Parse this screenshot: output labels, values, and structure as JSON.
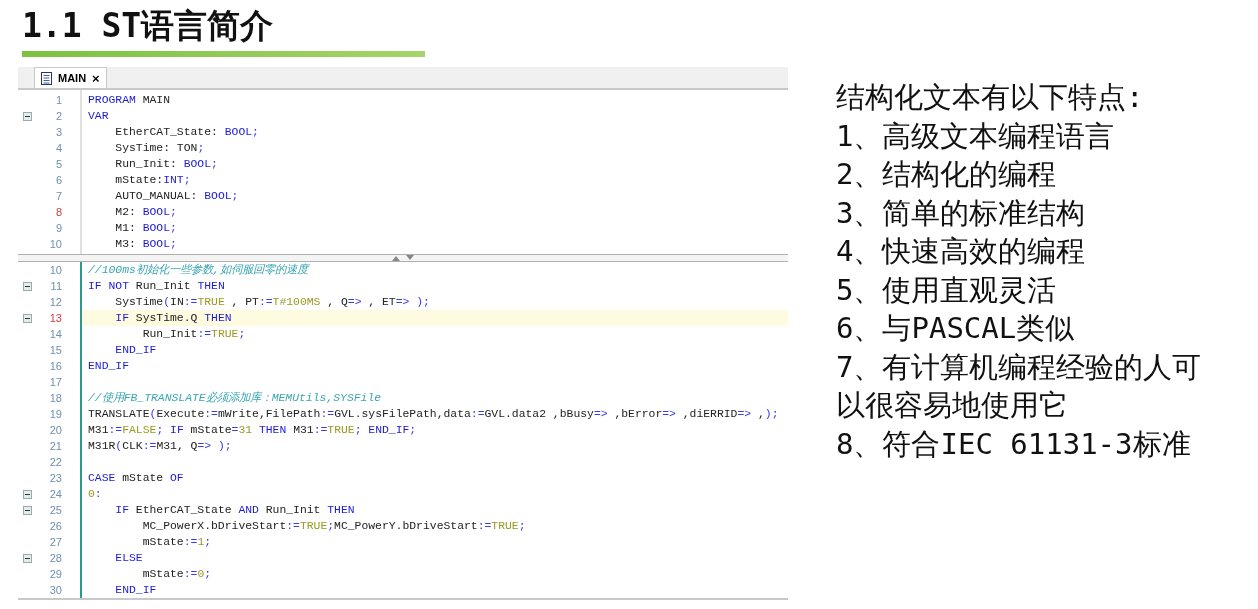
{
  "title": "1.1 ST语言简介",
  "editor": {
    "tab": {
      "label": "MAIN",
      "close": "×"
    },
    "top_pane": [
      {
        "number": "1",
        "folding": false,
        "marked": false,
        "current": false,
        "segments": [
          {
            "kind": "keyword",
            "text": "PROGRAM"
          },
          {
            "kind": "plain",
            "text": " MAIN"
          }
        ]
      },
      {
        "number": "2",
        "folding": true,
        "marked": false,
        "current": false,
        "segments": [
          {
            "kind": "keyword",
            "text": "VAR"
          }
        ]
      },
      {
        "number": "3",
        "folding": false,
        "marked": false,
        "current": false,
        "segments": [
          {
            "kind": "plain",
            "text": "    EtherCAT_State: "
          },
          {
            "kind": "keyword",
            "text": "BOOL"
          },
          {
            "kind": "operator",
            "text": ";"
          }
        ]
      },
      {
        "number": "4",
        "folding": false,
        "marked": false,
        "current": false,
        "segments": [
          {
            "kind": "plain",
            "text": "    SysTime: TON"
          },
          {
            "kind": "operator",
            "text": ";"
          }
        ]
      },
      {
        "number": "5",
        "folding": false,
        "marked": false,
        "current": false,
        "segments": [
          {
            "kind": "plain",
            "text": "    Run_Init: "
          },
          {
            "kind": "keyword",
            "text": "BOOL"
          },
          {
            "kind": "operator",
            "text": ";"
          }
        ]
      },
      {
        "number": "6",
        "folding": false,
        "marked": false,
        "current": false,
        "segments": [
          {
            "kind": "plain",
            "text": "    mState:"
          },
          {
            "kind": "keyword",
            "text": "INT"
          },
          {
            "kind": "operator",
            "text": ";"
          }
        ]
      },
      {
        "number": "7",
        "folding": false,
        "marked": false,
        "current": false,
        "segments": [
          {
            "kind": "plain",
            "text": "    AUTO_MANUAL: "
          },
          {
            "kind": "keyword",
            "text": "BOOL"
          },
          {
            "kind": "operator",
            "text": ";"
          }
        ]
      },
      {
        "number": "8",
        "folding": false,
        "marked": true,
        "current": false,
        "segments": [
          {
            "kind": "plain",
            "text": "    M2: "
          },
          {
            "kind": "keyword",
            "text": "BOOL"
          },
          {
            "kind": "operator",
            "text": ";"
          }
        ]
      },
      {
        "number": "9",
        "folding": false,
        "marked": false,
        "current": false,
        "segments": [
          {
            "kind": "plain",
            "text": "    M1: "
          },
          {
            "kind": "keyword",
            "text": "BOOL"
          },
          {
            "kind": "operator",
            "text": ";"
          }
        ]
      },
      {
        "number": "10",
        "folding": false,
        "marked": false,
        "current": false,
        "segments": [
          {
            "kind": "plain",
            "text": "    M3: "
          },
          {
            "kind": "keyword",
            "text": "BOOL"
          },
          {
            "kind": "operator",
            "text": ";"
          }
        ]
      }
    ],
    "bottom_pane": [
      {
        "number": "10",
        "folding": false,
        "marked": false,
        "current": false,
        "segments": [
          {
            "kind": "comment",
            "text": "//100ms初始化一些参数,如伺服回零的速度"
          }
        ]
      },
      {
        "number": "11",
        "folding": true,
        "marked": false,
        "current": false,
        "segments": [
          {
            "kind": "keyword",
            "text": "IF"
          },
          {
            "kind": "keyword",
            "text": " NOT"
          },
          {
            "kind": "plain",
            "text": " Run_Init "
          },
          {
            "kind": "keyword",
            "text": "THEN"
          }
        ]
      },
      {
        "number": "12",
        "folding": false,
        "marked": false,
        "current": false,
        "segments": [
          {
            "kind": "plain",
            "text": "    SysTime"
          },
          {
            "kind": "operator",
            "text": "("
          },
          {
            "kind": "plain",
            "text": "IN"
          },
          {
            "kind": "operator",
            "text": ":="
          },
          {
            "kind": "literal",
            "text": "TRUE"
          },
          {
            "kind": "plain",
            "text": " , PT"
          },
          {
            "kind": "operator",
            "text": ":="
          },
          {
            "kind": "literal",
            "text": "T#100MS"
          },
          {
            "kind": "plain",
            "text": " , Q"
          },
          {
            "kind": "operator",
            "text": "=>"
          },
          {
            "kind": "plain",
            "text": " , ET"
          },
          {
            "kind": "operator",
            "text": "=>"
          },
          {
            "kind": "operator",
            "text": " );"
          }
        ]
      },
      {
        "number": "13",
        "folding": true,
        "marked": true,
        "current": true,
        "segments": [
          {
            "kind": "keyword",
            "text": "    IF"
          },
          {
            "kind": "plain",
            "text": " SysTime.Q "
          },
          {
            "kind": "keyword",
            "text": "THEN"
          }
        ]
      },
      {
        "number": "14",
        "folding": false,
        "marked": false,
        "current": false,
        "segments": [
          {
            "kind": "plain",
            "text": "        Run_Init"
          },
          {
            "kind": "operator",
            "text": ":="
          },
          {
            "kind": "literal",
            "text": "TRUE"
          },
          {
            "kind": "operator",
            "text": ";"
          }
        ]
      },
      {
        "number": "15",
        "folding": false,
        "marked": false,
        "current": false,
        "segments": [
          {
            "kind": "keyword",
            "text": "    END_IF"
          }
        ]
      },
      {
        "number": "16",
        "folding": false,
        "marked": false,
        "current": false,
        "segments": [
          {
            "kind": "keyword",
            "text": "END_IF"
          }
        ]
      },
      {
        "number": "17",
        "folding": false,
        "marked": false,
        "current": false
      },
      {
        "number": "18",
        "folding": false,
        "marked": false,
        "current": false,
        "segments": [
          {
            "kind": "comment",
            "text": "//使用FB_TRANSLATE必须添加库：MEMUtils,SYSFile"
          }
        ]
      },
      {
        "number": "19",
        "folding": false,
        "marked": false,
        "current": false,
        "segments": [
          {
            "kind": "plain",
            "text": "TRANSLATE"
          },
          {
            "kind": "operator",
            "text": "("
          },
          {
            "kind": "plain",
            "text": "Execute"
          },
          {
            "kind": "operator",
            "text": ":="
          },
          {
            "kind": "plain",
            "text": "mWrite,FilePath"
          },
          {
            "kind": "operator",
            "text": ":="
          },
          {
            "kind": "plain",
            "text": "GVL.sysFilePath,data"
          },
          {
            "kind": "operator",
            "text": ":="
          },
          {
            "kind": "plain",
            "text": "GVL.data2 ,bBusy"
          },
          {
            "kind": "operator",
            "text": "=>"
          },
          {
            "kind": "plain",
            "text": " ,bError"
          },
          {
            "kind": "operator",
            "text": "=>"
          },
          {
            "kind": "plain",
            "text": " ,diERRID"
          },
          {
            "kind": "operator",
            "text": "=>"
          },
          {
            "kind": "plain",
            "text": " ,"
          },
          {
            "kind": "operator",
            "text": ");"
          }
        ]
      },
      {
        "number": "20",
        "folding": false,
        "marked": false,
        "current": false,
        "segments": [
          {
            "kind": "plain",
            "text": "M31"
          },
          {
            "kind": "operator",
            "text": ":="
          },
          {
            "kind": "literal",
            "text": "FALSE"
          },
          {
            "kind": "operator",
            "text": ";"
          },
          {
            "kind": "keyword",
            "text": " IF"
          },
          {
            "kind": "plain",
            "text": " mState"
          },
          {
            "kind": "operator",
            "text": "="
          },
          {
            "kind": "literal",
            "text": "31"
          },
          {
            "kind": "keyword",
            "text": " THEN"
          },
          {
            "kind": "plain",
            "text": " M31"
          },
          {
            "kind": "operator",
            "text": ":="
          },
          {
            "kind": "literal",
            "text": "TRUE"
          },
          {
            "kind": "operator",
            "text": ";"
          },
          {
            "kind": "keyword",
            "text": " END_IF"
          },
          {
            "kind": "operator",
            "text": ";"
          }
        ]
      },
      {
        "number": "21",
        "folding": false,
        "marked": false,
        "current": false,
        "segments": [
          {
            "kind": "plain",
            "text": "M31R"
          },
          {
            "kind": "operator",
            "text": "("
          },
          {
            "kind": "plain",
            "text": "CLK"
          },
          {
            "kind": "operator",
            "text": ":="
          },
          {
            "kind": "plain",
            "text": "M31, Q"
          },
          {
            "kind": "operator",
            "text": "=>"
          },
          {
            "kind": "operator",
            "text": " );"
          }
        ]
      },
      {
        "number": "22",
        "folding": false,
        "marked": false,
        "current": false
      },
      {
        "number": "23",
        "folding": false,
        "marked": false,
        "current": false,
        "segments": [
          {
            "kind": "keyword",
            "text": "CASE"
          },
          {
            "kind": "plain",
            "text": " mState "
          },
          {
            "kind": "keyword",
            "text": "OF"
          }
        ]
      },
      {
        "number": "24",
        "folding": true,
        "marked": false,
        "current": false,
        "segments": [
          {
            "kind": "literal",
            "text": "0"
          },
          {
            "kind": "operator",
            "text": ":"
          }
        ]
      },
      {
        "number": "25",
        "folding": true,
        "marked": false,
        "current": false,
        "segments": [
          {
            "kind": "keyword",
            "text": "    IF"
          },
          {
            "kind": "plain",
            "text": " EtherCAT_State "
          },
          {
            "kind": "keyword",
            "text": "AND"
          },
          {
            "kind": "plain",
            "text": " Run_Init "
          },
          {
            "kind": "keyword",
            "text": "THEN"
          }
        ]
      },
      {
        "number": "26",
        "folding": false,
        "marked": false,
        "current": false,
        "segments": [
          {
            "kind": "plain",
            "text": "        MC_PowerX.bDriveStart"
          },
          {
            "kind": "operator",
            "text": ":="
          },
          {
            "kind": "literal",
            "text": "TRUE"
          },
          {
            "kind": "operator",
            "text": ";"
          },
          {
            "kind": "plain",
            "text": "MC_PowerY.bDriveStart"
          },
          {
            "kind": "operator",
            "text": ":="
          },
          {
            "kind": "literal",
            "text": "TRUE"
          },
          {
            "kind": "operator",
            "text": ";"
          }
        ]
      },
      {
        "number": "27",
        "folding": false,
        "marked": false,
        "current": false,
        "segments": [
          {
            "kind": "plain",
            "text": "        mState"
          },
          {
            "kind": "operator",
            "text": ":="
          },
          {
            "kind": "literal",
            "text": "1"
          },
          {
            "kind": "operator",
            "text": ";"
          }
        ]
      },
      {
        "number": "28",
        "folding": true,
        "marked": false,
        "current": false,
        "segments": [
          {
            "kind": "keyword",
            "text": "    ELSE"
          }
        ]
      },
      {
        "number": "29",
        "folding": false,
        "marked": false,
        "current": false,
        "segments": [
          {
            "kind": "plain",
            "text": "        mState"
          },
          {
            "kind": "operator",
            "text": ":="
          },
          {
            "kind": "literal",
            "text": "0"
          },
          {
            "kind": "operator",
            "text": ";"
          }
        ]
      },
      {
        "number": "30",
        "folding": false,
        "marked": false,
        "current": false,
        "segments": [
          {
            "kind": "keyword",
            "text": "    END_IF"
          }
        ]
      }
    ]
  },
  "features": {
    "heading": "结构化文本有以下特点:",
    "items": [
      "1、高级文本编程语言",
      "2、结构化的编程",
      "3、简单的标准结构",
      "4、快速高效的编程",
      "5、使用直观灵活",
      "6、与PASCAL类似",
      "7、有计算机编程经验的人可以很容易地使用它",
      "8、符合IEC 61131-3标准"
    ]
  }
}
